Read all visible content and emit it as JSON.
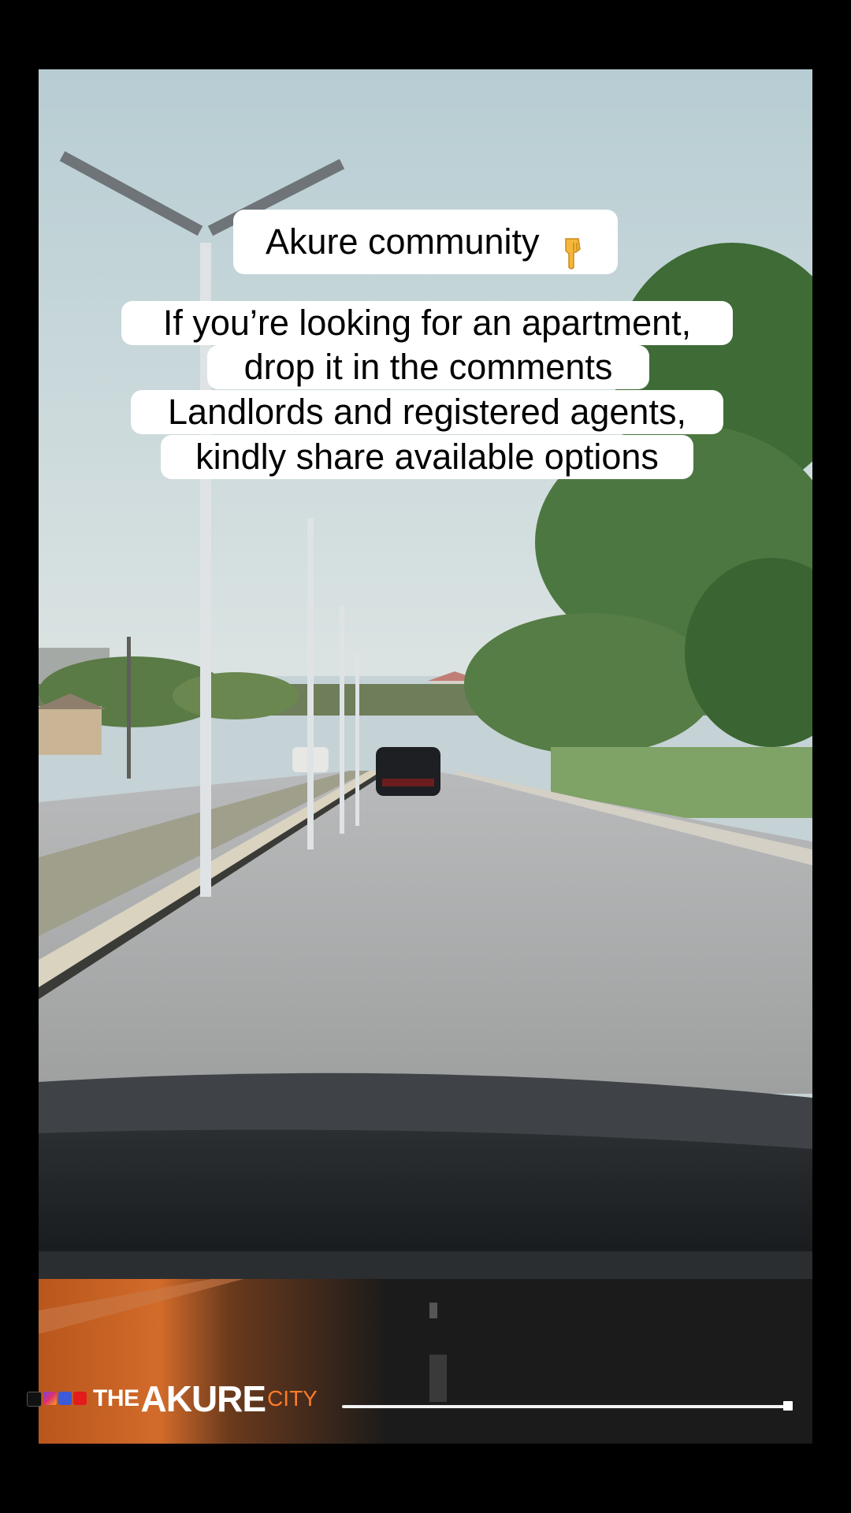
{
  "overlay": {
    "title": "Akure community",
    "title_emoji": "pointing-down-hand-icon",
    "lines": [
      "If you’re looking for an apartment,",
      "drop it in the comments",
      "Landlords and registered agents,",
      "kindly share available options"
    ]
  },
  "banner": {
    "brand_prefix": "THE",
    "brand_name": "AKURE",
    "brand_suffix": "CITY",
    "social_icons": [
      "tiktok-icon",
      "instagram-icon",
      "facebook-icon",
      "youtube-icon"
    ],
    "playback_progress": 1.0,
    "accent_color": "#e86b1f"
  }
}
